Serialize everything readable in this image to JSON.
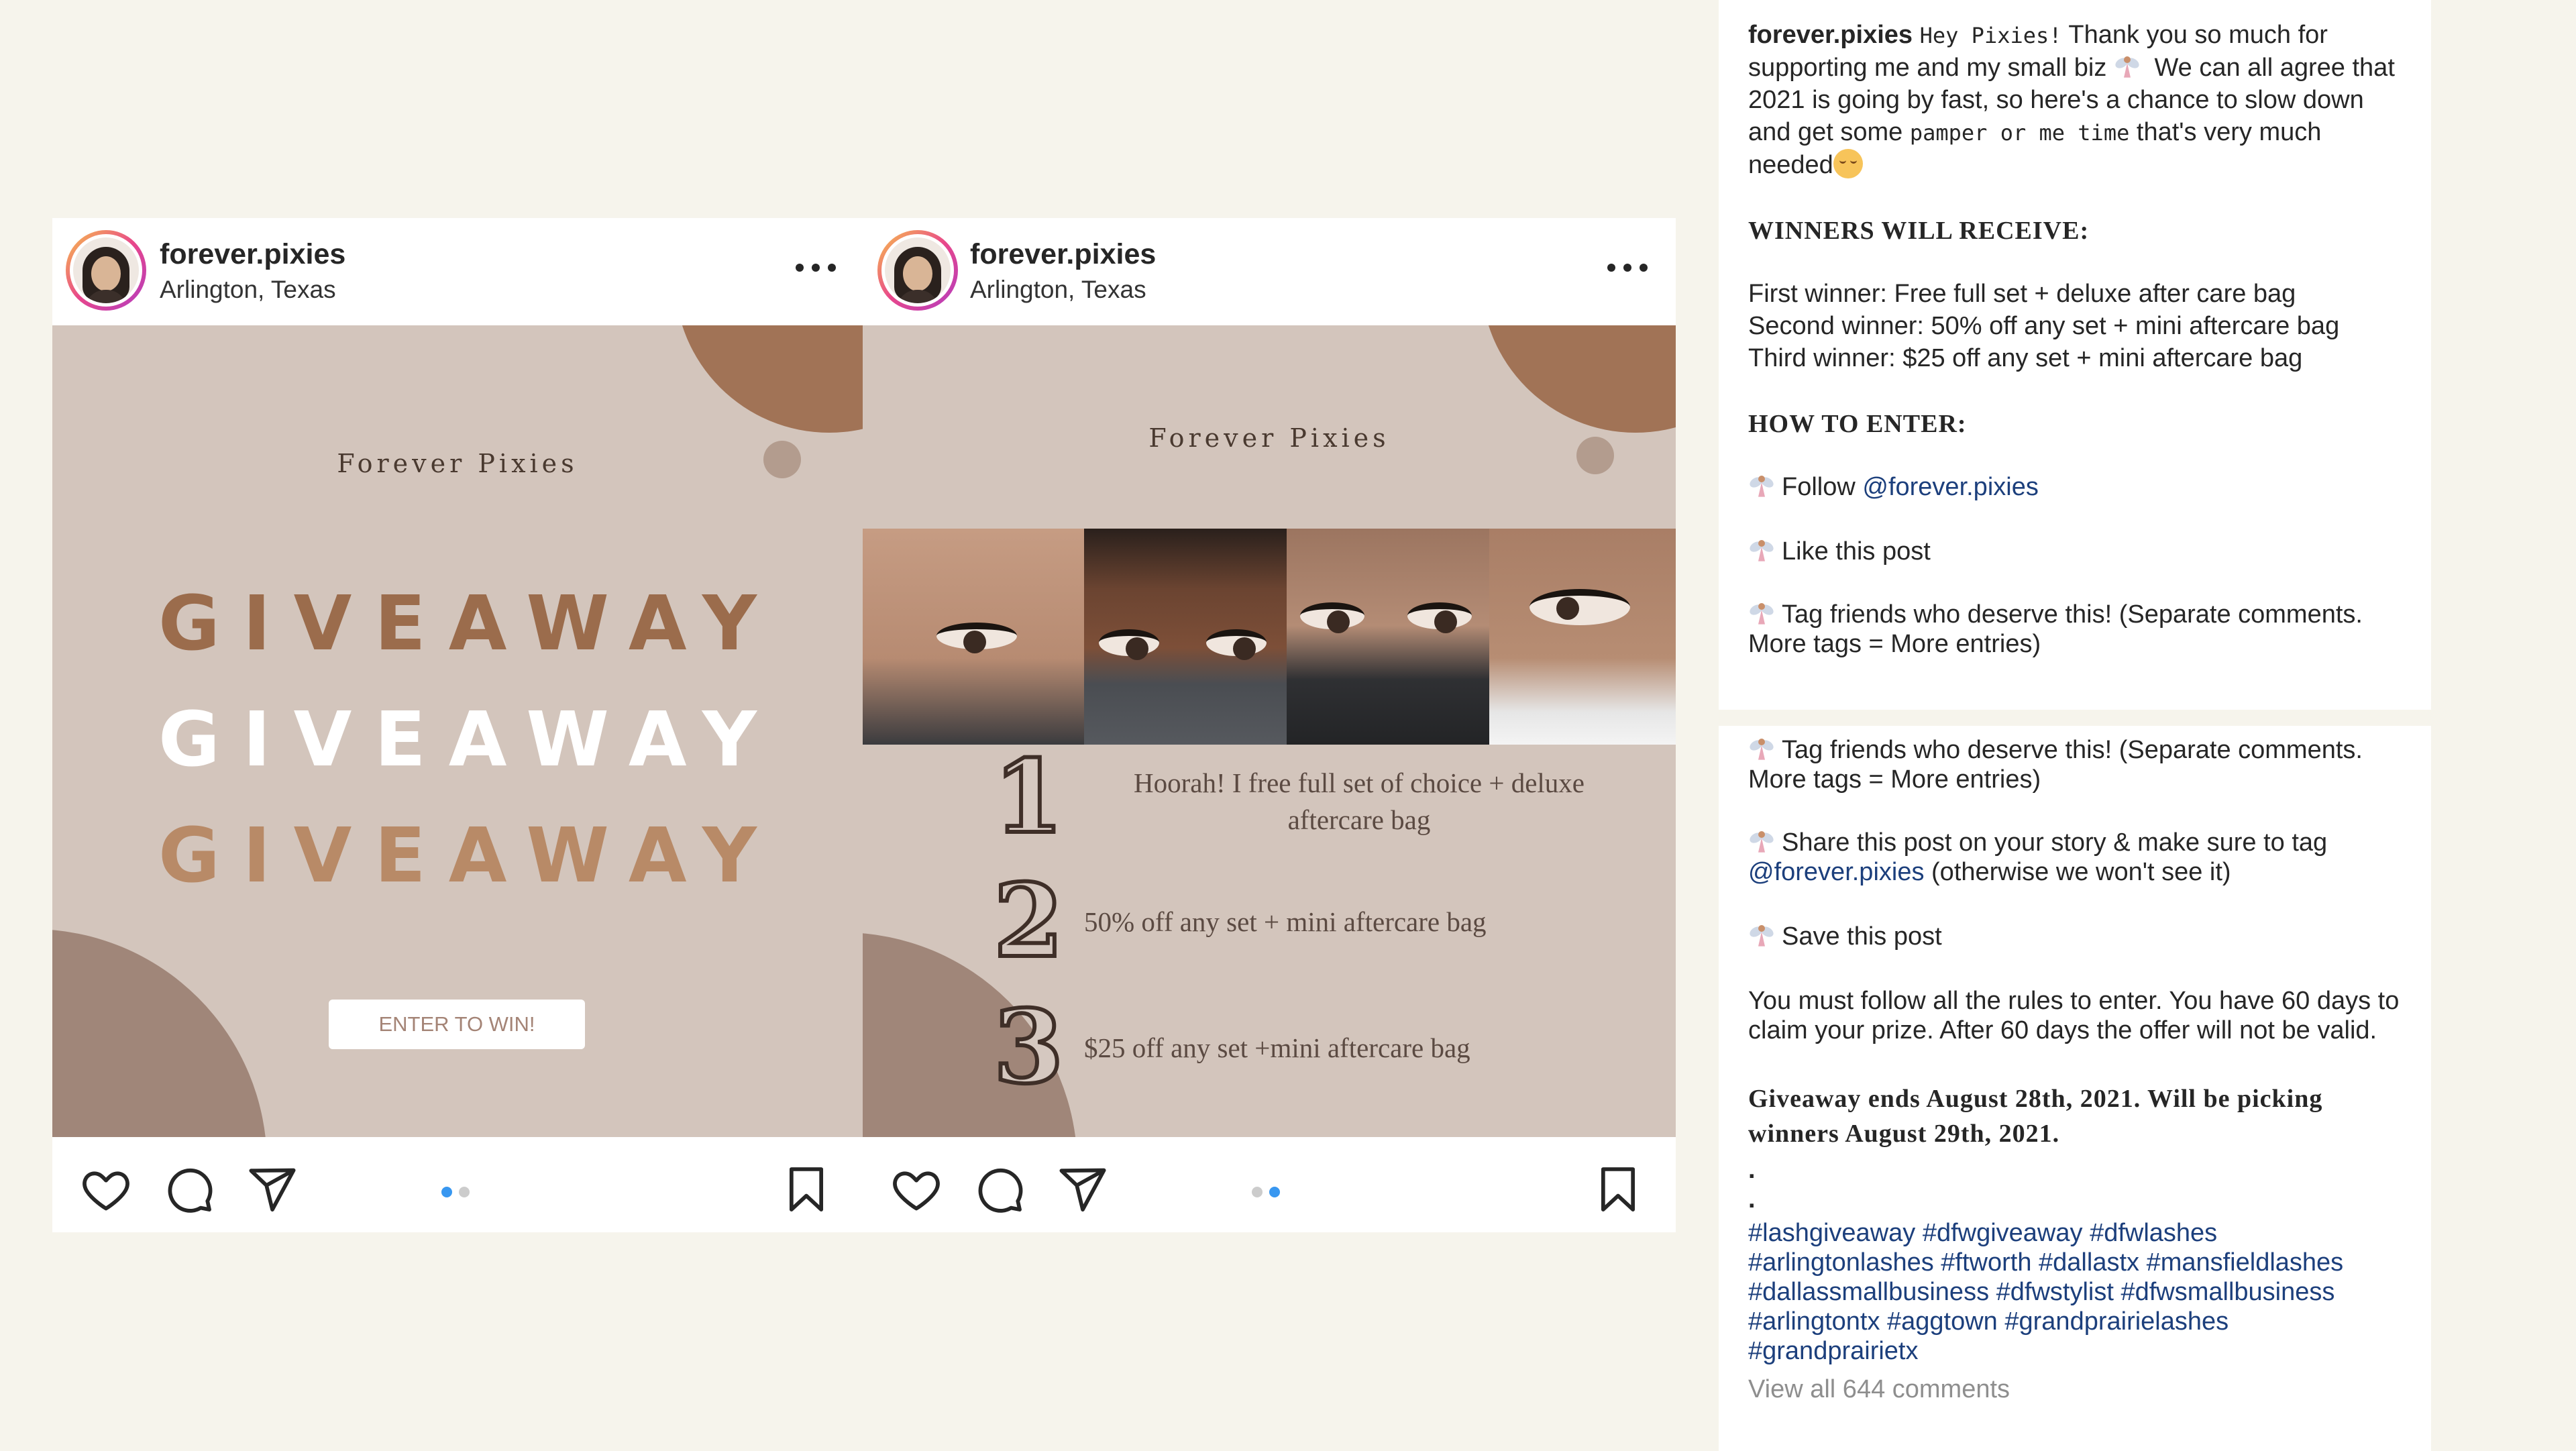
{
  "colors": {
    "background": "#f6f4ec",
    "card_bg": "#d3c5bc",
    "accent_brown": "#a17356",
    "link_blue": "#1c3f7c",
    "carousel_active": "#3897f0"
  },
  "posts": [
    {
      "username": "forever.pixies",
      "location": "Arlington, Texas",
      "brand": "Forever Pixies",
      "giveaway_lines": [
        "GIVEAWAY",
        "GIVEAWAY",
        "GIVEAWAY"
      ],
      "button_label": "ENTER TO WIN!",
      "carousel_active_index": 0
    },
    {
      "username": "forever.pixies",
      "location": "Arlington, Texas",
      "brand": "Forever Pixies",
      "prizes": [
        {
          "num": "1",
          "text": "Hoorah! I free full set of choice + deluxe aftercare bag"
        },
        {
          "num": "2",
          "text": "50% off any set + mini aftercare bag"
        },
        {
          "num": "3",
          "text": "$25 off any set +mini aftercare bag"
        }
      ],
      "carousel_active_index": 1
    }
  ],
  "icons": [
    "heart-icon",
    "comment-icon",
    "share-icon",
    "bookmark-icon",
    "more-icon",
    "fairy-icon"
  ],
  "caption": {
    "username": "forever.pixies",
    "intro_mono_1": "Hey Pixies!",
    "intro_text_1": "Thank you so much for supporting me and my small biz",
    "intro_text_2": "We can all agree that 2021 is going by fast, so here's a chance to slow down and get some",
    "intro_mono_2": "pamper or me time",
    "intro_text_3": "that's very much needed",
    "winners_heading": "WINNERS WILL RECEIVE:",
    "winners": [
      "First winner: Free full set + deluxe after care bag",
      "Second winner: 50% off any set + mini aftercare bag",
      "Third winner: $25 off any set + mini aftercare bag"
    ],
    "how_heading": "HOW TO ENTER:",
    "follow_text": "Follow",
    "handle": "@forever.pixies",
    "like_text": "Like this post",
    "tag_text": "Tag friends who deserve this! (Separate comments. More tags = More entries)",
    "tag_text_repeat": "Tag friends who deserve this! (Separate comments. More tags = More entries)",
    "share_text": "Share this post on your story & make sure to tag",
    "share_suffix": "(otherwise we won't see it)",
    "save_text": "Save this post",
    "rules_text": "You must follow all the rules to enter. You have 60 days to claim your prize. After 60 days the offer will not be valid.",
    "ends_text": "Giveaway ends August 28th, 2021. Will be picking winners August 29th, 2021.",
    "dot1": ".",
    "dot2": ".",
    "hashtags": "#lashgiveaway #dfwgiveaway #dfwlashes #arlingtonlashes #ftworth #dallastx #mansfieldlashes #dallassmallbusiness #dfwstylist #dfwsmallbusiness #arlingtontx #aggtown #grandprairielashes #grandprairietx",
    "view_all": "View all 644 comments"
  }
}
